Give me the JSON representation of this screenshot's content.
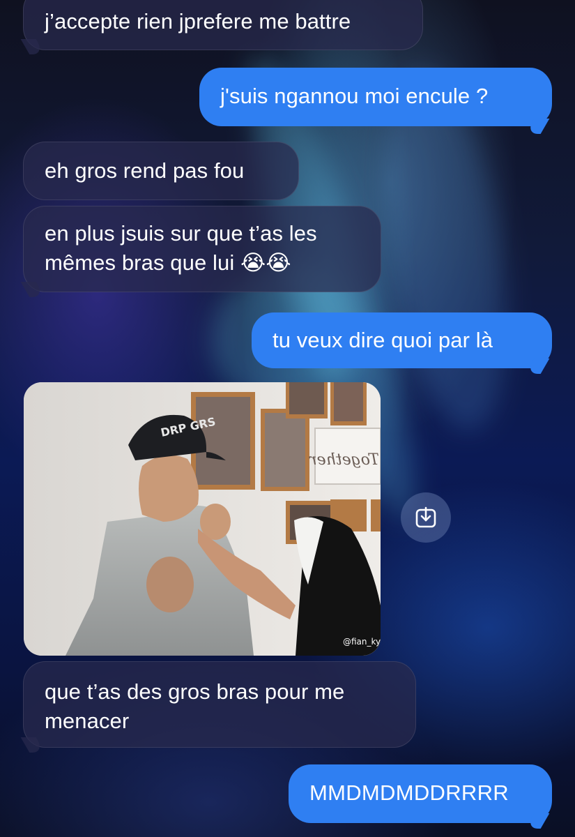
{
  "messages": [
    {
      "id": "m1",
      "side": "incoming",
      "text": "j’accepte rien jprefere me battre"
    },
    {
      "id": "m2",
      "side": "outgoing",
      "text": "j'suis ngannou moi encule ?"
    },
    {
      "id": "m3",
      "side": "incoming",
      "text": "eh gros rend pas fou"
    },
    {
      "id": "m4",
      "side": "incoming",
      "line1": "en plus jsuis sur que t’as les",
      "line2": "mêmes bras que lui 😭😭"
    },
    {
      "id": "m5",
      "side": "outgoing",
      "text": "tu veux dire quoi par là"
    },
    {
      "id": "m6",
      "side": "incoming",
      "line1": "que t’as des gros bras pour me",
      "line2": "menacer"
    },
    {
      "id": "m7",
      "side": "outgoing",
      "text": "MMDMDMDDRRRR"
    }
  ],
  "media": {
    "type": "video",
    "watermark": "@fian_ky",
    "sign_text": "Together",
    "cap_text": "DRP GRS",
    "save_icon": "download-icon"
  },
  "colors": {
    "outgoing_bubble": "#2f7ff2",
    "incoming_bubble": "#2a2c4e",
    "text": "#ffffff"
  }
}
